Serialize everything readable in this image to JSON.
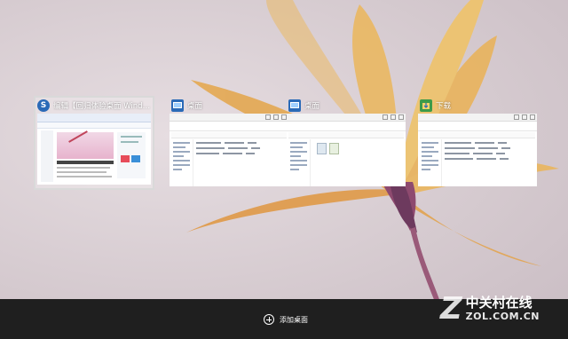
{
  "thumbnails": [
    {
      "title": "编辑【回归体验桌面 Windows10...",
      "icon": "sogou-browser-icon",
      "selected": true
    },
    {
      "title": "桌面",
      "icon": "desktop-icon",
      "selected": false
    },
    {
      "title": "桌面",
      "icon": "desktop-icon",
      "selected": false
    },
    {
      "title": "下载",
      "icon": "download-folder-icon",
      "selected": false
    }
  ],
  "taskbar": {
    "add_desktop_label": "添加桌面"
  },
  "watermark": {
    "logo": "Z",
    "cn": "中关村在线",
    "en": "ZOL.COM.CN"
  },
  "colors": {
    "taskbar": "#1f1f1f",
    "accent_blue": "#2a6ab7",
    "folder_green": "#3c9b49"
  }
}
